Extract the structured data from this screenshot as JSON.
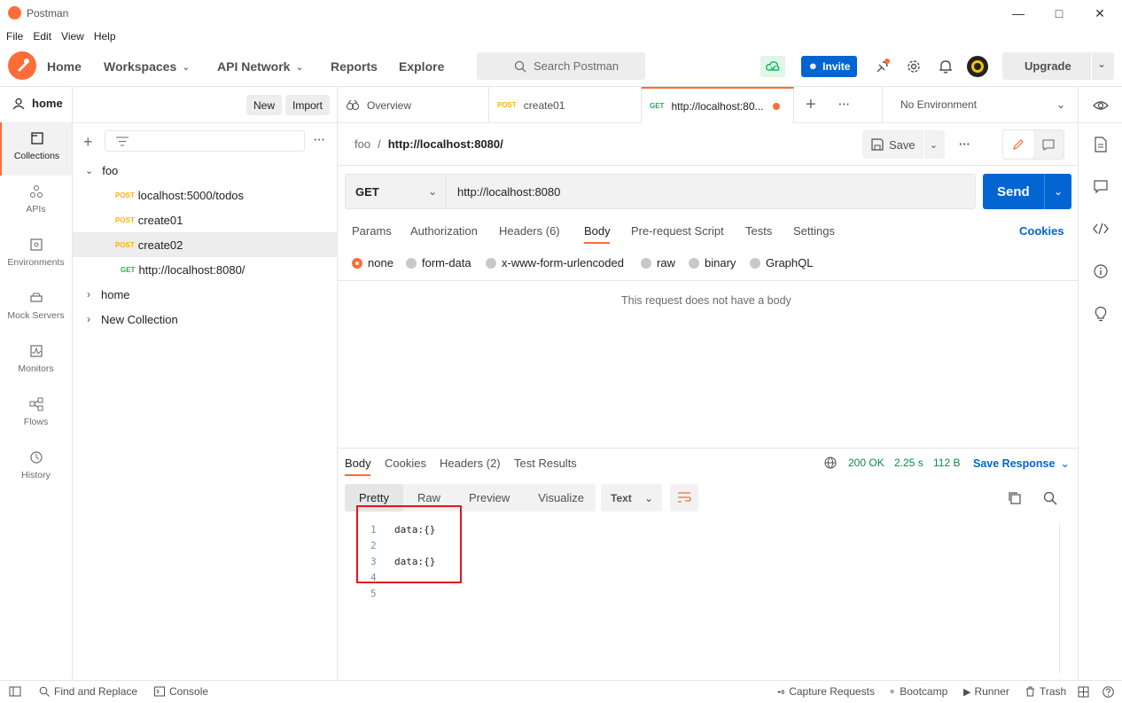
{
  "window": {
    "title": "Postman"
  },
  "menu": [
    "File",
    "Edit",
    "View",
    "Help"
  ],
  "header": {
    "nav": {
      "home": "Home",
      "workspaces": "Workspaces",
      "api_network": "API Network",
      "reports": "Reports",
      "explore": "Explore"
    },
    "search_placeholder": "Search Postman",
    "invite": "Invite",
    "upgrade": "Upgrade"
  },
  "rail": [
    "Collections",
    "APIs",
    "Environments",
    "Mock Servers",
    "Monitors",
    "Flows",
    "History"
  ],
  "sidebar": {
    "workspace": "home",
    "new_label": "New",
    "import_label": "Import",
    "tree": {
      "foo": "foo",
      "items": [
        {
          "method": "POST",
          "name": "localhost:5000/todos"
        },
        {
          "method": "POST",
          "name": "create01"
        },
        {
          "method": "POST",
          "name": "create02"
        },
        {
          "method": "GET",
          "name": "http://localhost:8080/"
        }
      ],
      "home": "home",
      "new_collection": "New Collection"
    }
  },
  "tabs": {
    "overview": "Overview",
    "tab1_method": "POST",
    "tab1_name": "create01",
    "tab2_method": "GET",
    "tab2_name": "http://localhost:80...",
    "environment": "No Environment"
  },
  "request": {
    "breadcrumb_parent": "foo",
    "breadcrumb_sep": "/",
    "breadcrumb_name": "http://localhost:8080/",
    "save_label": "Save",
    "method": "GET",
    "url": "http://localhost:8080",
    "send_label": "Send",
    "tabs": {
      "params": "Params",
      "authorization": "Authorization",
      "headers": "Headers (6)",
      "body": "Body",
      "prerequest": "Pre-request Script",
      "tests": "Tests",
      "settings": "Settings",
      "cookies": "Cookies"
    },
    "body_types": [
      "none",
      "form-data",
      "x-www-form-urlencoded",
      "raw",
      "binary",
      "GraphQL"
    ],
    "no_body_text": "This request does not have a body"
  },
  "response": {
    "tabs": {
      "body": "Body",
      "cookies": "Cookies",
      "headers": "Headers (2)",
      "tests": "Test Results"
    },
    "status": "200 OK",
    "time": "2.25 s",
    "size": "112 B",
    "save_response": "Save Response",
    "views": [
      "Pretty",
      "Raw",
      "Preview",
      "Visualize"
    ],
    "format": "Text",
    "lines": [
      {
        "n": "1",
        "text": "data:{}"
      },
      {
        "n": "2",
        "text": ""
      },
      {
        "n": "3",
        "text": "data:{}"
      },
      {
        "n": "4",
        "text": ""
      },
      {
        "n": "5",
        "text": ""
      }
    ]
  },
  "statusbar": {
    "find_replace": "Find and Replace",
    "console": "Console",
    "capture": "Capture Requests",
    "bootcamp": "Bootcamp",
    "runner": "Runner",
    "trash": "Trash"
  },
  "colors": {
    "brand": "#ff6c37",
    "primary": "#0265d2",
    "post": "#ffb400",
    "get": "#0cbb52",
    "highlight": "#e3141b"
  }
}
